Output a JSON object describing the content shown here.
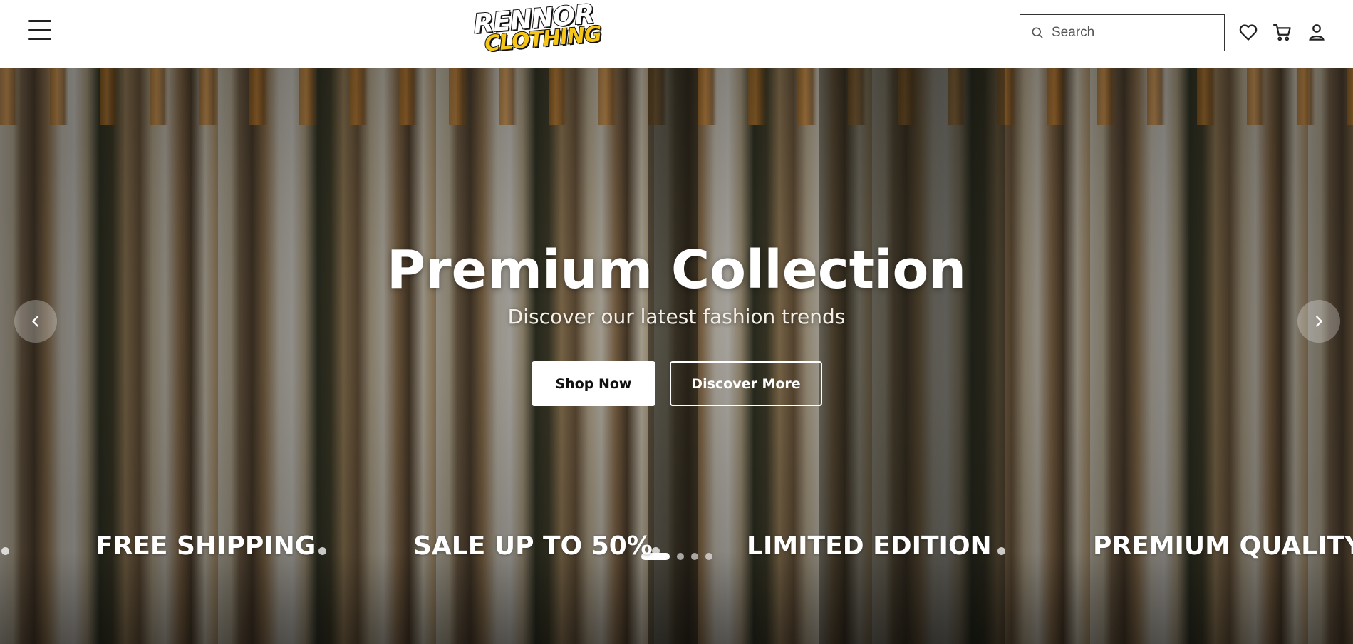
{
  "header": {
    "logo": {
      "line1": "RENNOR",
      "line2": "CLOTHING"
    },
    "search": {
      "placeholder": "Search"
    },
    "icons": [
      "menu-icon",
      "search-icon",
      "heart-icon",
      "cart-icon",
      "user-icon"
    ]
  },
  "hero": {
    "title": "Premium Collection",
    "subtitle": "Discover our latest fashion trends",
    "primary_button": "Shop Now",
    "secondary_button": "Discover More",
    "slides": {
      "count": 4,
      "active": 1
    },
    "icons": [
      "chevron-left-icon",
      "chevron-right-icon"
    ]
  },
  "marquee": {
    "items": [
      "FREE SHIPPING",
      "SALE UP TO 50%",
      "LIMITED EDITION",
      "PREMIUM QUALITY"
    ]
  },
  "colors": {
    "text_dark": "#222222",
    "logo_yellow": "#f5c518",
    "white": "#ffffff"
  }
}
